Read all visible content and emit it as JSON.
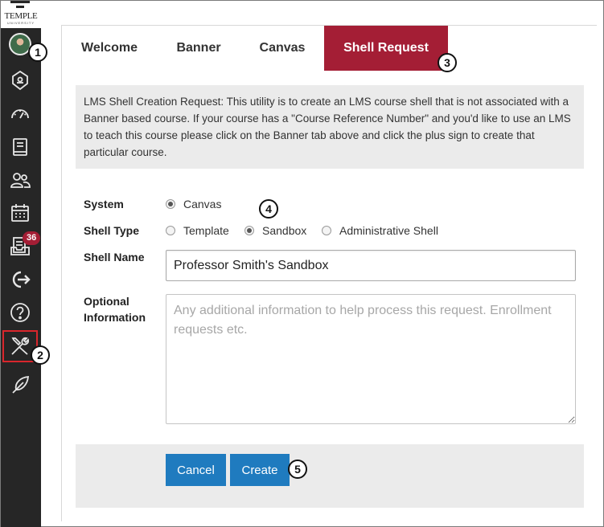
{
  "logo": {
    "text": "TEMPLE",
    "subtext": "UNIVERSITY"
  },
  "sidebar": {
    "icons": [
      "avatar",
      "tag-icon",
      "speedometer-icon",
      "book-icon",
      "users-icon",
      "calendar-icon",
      "inbox-icon",
      "logout-icon",
      "help-icon",
      "tools-icon",
      "feather-icon"
    ],
    "inbox_badge": "36"
  },
  "tabs": [
    {
      "label": "Welcome"
    },
    {
      "label": "Banner"
    },
    {
      "label": "Canvas"
    },
    {
      "label": "Shell Request",
      "active": true
    }
  ],
  "intro_text": "LMS Shell Creation Request: This utility is to create an LMS course shell that is not associated with a Banner based course. If your course has a \"Course Reference Number\" and you'd like to use an LMS to teach this course please click on the Banner tab above and click the plus sign to create that particular course.",
  "form": {
    "system_label": "System",
    "system_options": [
      {
        "label": "Canvas",
        "checked": true
      }
    ],
    "shell_type_label": "Shell Type",
    "shell_type_options": [
      {
        "label": "Template",
        "checked": false
      },
      {
        "label": "Sandbox",
        "checked": true
      },
      {
        "label": "Administrative Shell",
        "checked": false
      }
    ],
    "shell_name_label": "Shell Name",
    "shell_name_value": "Professor Smith's Sandbox",
    "optional_label_line1": "Optional",
    "optional_label_line2": "Information",
    "optional_placeholder": "Any additional information to help process this request. Enrollment requests etc."
  },
  "buttons": {
    "cancel": "Cancel",
    "create": "Create"
  },
  "callouts": [
    "1",
    "2",
    "3",
    "4",
    "5"
  ],
  "colors": {
    "accent": "#a41e35",
    "button": "#1f7bbf",
    "sidebar": "#262626",
    "highlight": "#d9262c"
  }
}
